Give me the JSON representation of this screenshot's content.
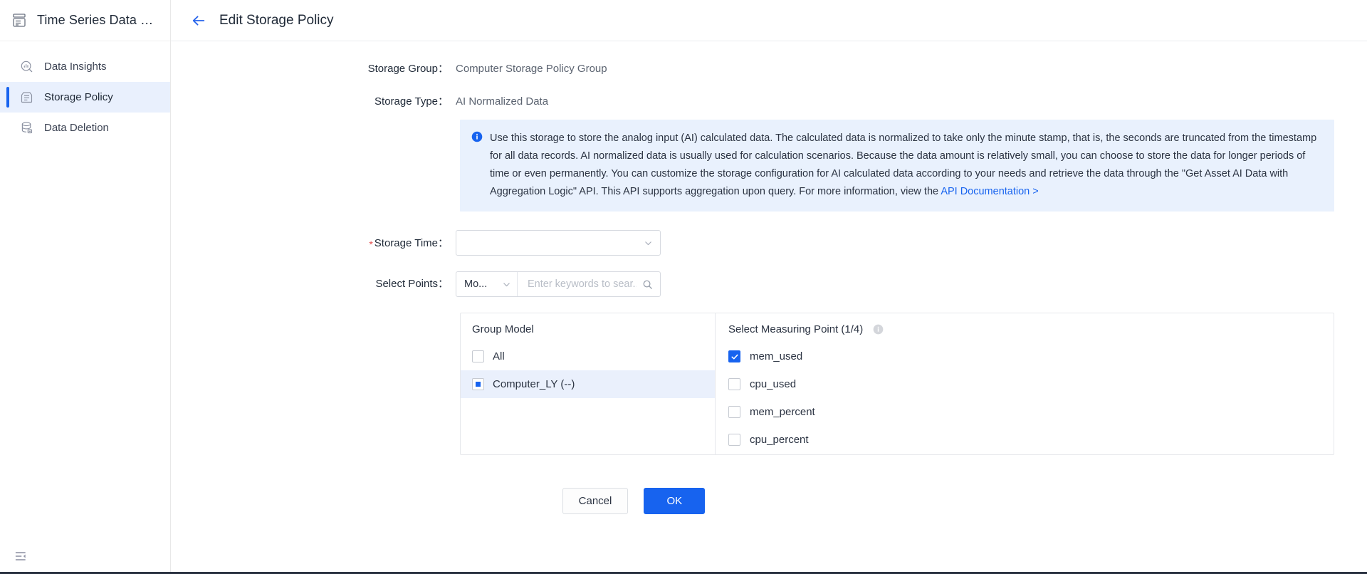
{
  "sidebar": {
    "app_title": "Time Series Data …",
    "app_logo_icon": "database-stack-icon",
    "items": [
      {
        "label": "Data Insights",
        "icon": "chart-search-icon",
        "active": false
      },
      {
        "label": "Storage Policy",
        "icon": "storage-layers-icon",
        "active": true
      },
      {
        "label": "Data Deletion",
        "icon": "database-delete-icon",
        "active": false
      }
    ],
    "collapse_icon": "collapse-sidebar-icon"
  },
  "header": {
    "back_icon": "back-arrow-icon",
    "title": "Edit Storage Policy"
  },
  "form": {
    "storage_group_label": "Storage Group：",
    "storage_group_value": "Computer Storage Policy Group",
    "storage_type_label": "Storage Type：",
    "storage_type_value": "AI Normalized Data",
    "storage_time_label": "Storage Time：",
    "storage_time_required": "*",
    "storage_time_value": "",
    "storage_time_caret_icon": "chevron-down-icon",
    "select_points_label": "Select Points：",
    "points_mode_value": "Mo...",
    "points_mode_caret_icon": "chevron-down-icon",
    "points_search_placeholder": "Enter keywords to sear...",
    "points_search_value": "",
    "points_search_icon": "search-icon"
  },
  "alert": {
    "icon": "info-circle-filled-icon",
    "text": "Use this storage to store the analog input (AI) calculated data. The calculated data is normalized to take only the minute stamp, that is, the seconds are truncated from the timestamp for all data records. AI normalized data is usually used for calculation scenarios. Because the data amount is relatively small, you can choose to store the data for longer periods of time or even permanently. You can customize the storage configuration for AI calculated data according to your needs and retrieve the data through the \"Get Asset AI Data with Aggregation Logic\" API. This API supports aggregation upon query. For more information, view the ",
    "link_text": "API Documentation >"
  },
  "transfer": {
    "left": {
      "heading": "Group Model",
      "items": [
        {
          "label": "All",
          "state": "unchecked",
          "selected": false
        },
        {
          "label": "Computer_LY (--)",
          "state": "indeterminate",
          "selected": true
        }
      ]
    },
    "right": {
      "heading": "Select Measuring Point (1/4)",
      "info_icon": "info-circle-icon",
      "items": [
        {
          "label": "mem_used",
          "state": "checked"
        },
        {
          "label": "cpu_used",
          "state": "unchecked"
        },
        {
          "label": "mem_percent",
          "state": "unchecked"
        },
        {
          "label": "cpu_percent",
          "state": "unchecked"
        }
      ]
    }
  },
  "actions": {
    "cancel_label": "Cancel",
    "ok_label": "OK"
  },
  "colors": {
    "accent": "#1763ef",
    "alert_bg": "#e9f1fd",
    "active_nav_bg": "#e9f0fd",
    "required_red": "#e34d4d"
  }
}
